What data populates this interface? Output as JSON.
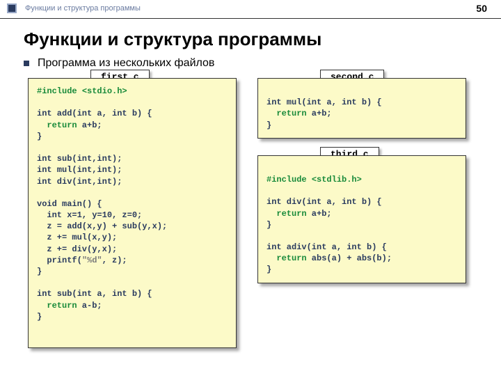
{
  "header": {
    "breadcrumb": "Функции и структура программы",
    "page_number": "50"
  },
  "title": "Функции и структура программы",
  "subtitle": "Программа из нескольких файлов",
  "files": {
    "first": {
      "name": "first.c",
      "include_kw": "#include",
      "include_hdr": "<stdio.h>",
      "line_add1": "int add(int a, int b) {",
      "line_add2_kw": "  return",
      "line_add2_rest": " a+b;",
      "line_add3": "}",
      "proto1": "int sub(int,int);",
      "proto2": "int mul(int,int);",
      "proto3": "int div(int,int);",
      "main1": "void main() {",
      "main2": "  int x=1, y=10, z=0;",
      "main3": "  z = add(x,y) + sub(y,x);",
      "main4": "  z += mul(x,y);",
      "main5": "  z += div(y,x);",
      "main6a": "  printf(",
      "main6b": "\"%d\"",
      "main6c": ", z);",
      "main7": "}",
      "sub1": "int sub(int a, int b) {",
      "sub2_kw": "  return",
      "sub2_rest": " a-b;",
      "sub3": "}"
    },
    "second": {
      "name": "second.c",
      "l1": "int mul(int a, int b) {",
      "l2_kw": "  return",
      "l2_rest": " a+b;",
      "l3": "}"
    },
    "third": {
      "name": "third.c",
      "include_kw": "#include",
      "include_hdr": "<stdlib.h>",
      "d1": "int div(int a, int b) {",
      "d2_kw": "  return",
      "d2_rest": " a+b;",
      "d3": "}",
      "a1": "int adiv(int a, int b) {",
      "a2_kw": "  return",
      "a2_rest": " abs(a) + abs(b);",
      "a3": "}"
    }
  }
}
